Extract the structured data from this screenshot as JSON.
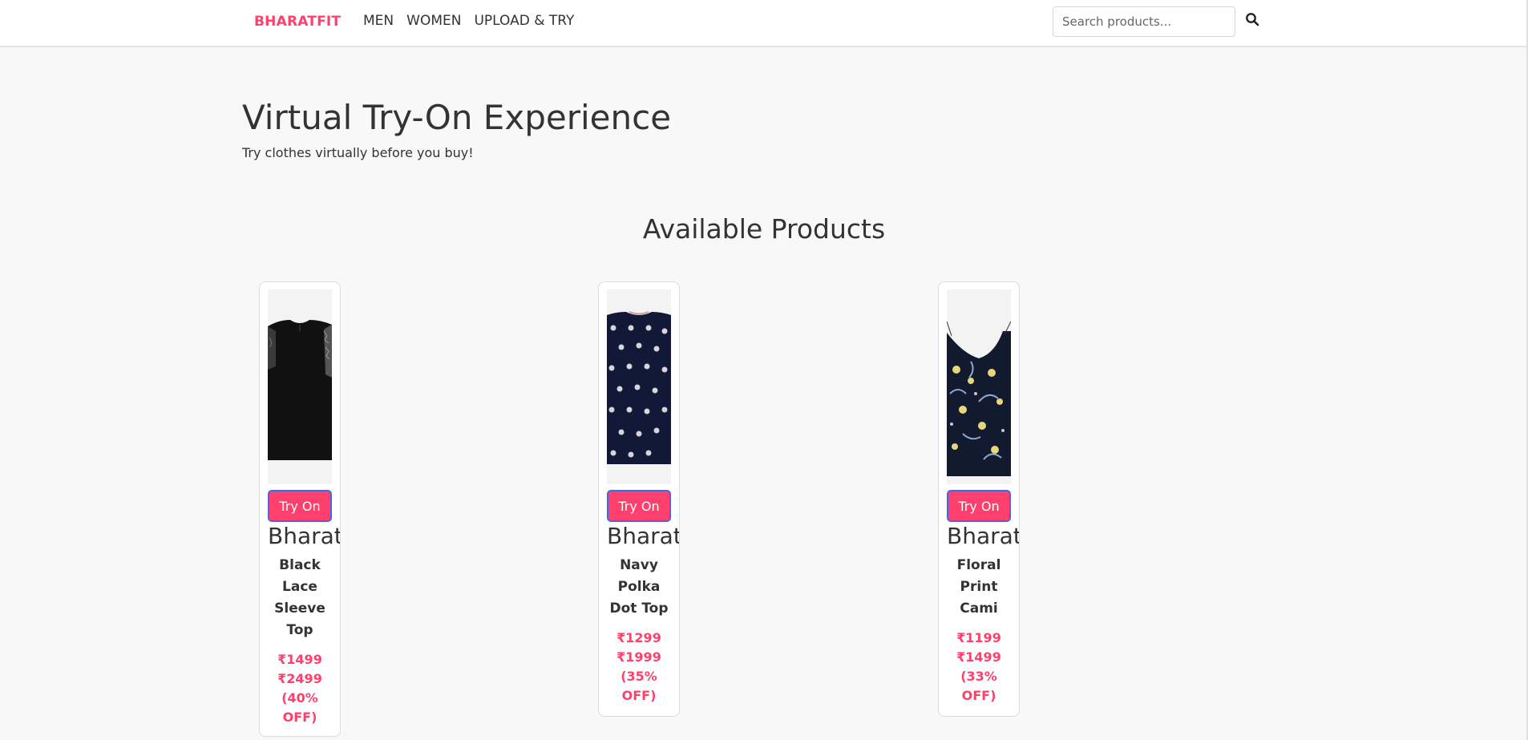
{
  "nav": {
    "brand": "BHARATFIT",
    "links": [
      "MEN",
      "WOMEN",
      "UPLOAD & TRY"
    ],
    "search_placeholder": "Search products...",
    "search_icon": "magnifier-icon"
  },
  "hero": {
    "title": "Virtual Try-On Experience",
    "subtitle": "Try clothes virtually before you buy!"
  },
  "products_section": {
    "title": "Available Products",
    "try_on_label": "Try On",
    "items": [
      {
        "brand": "BharatFit",
        "name": "Black Lace Sleeve Top",
        "price": "₹1499",
        "mrp": "₹2499",
        "discount": "(40% OFF)"
      },
      {
        "brand": "BharatFit",
        "name": "Navy Polka Dot Top",
        "price": "₹1299",
        "mrp": "₹1999",
        "discount": "(35% OFF)"
      },
      {
        "brand": "BharatFit",
        "name": "Floral Print Cami",
        "price": "₹1199",
        "mrp": "₹1499",
        "discount": "(33% OFF)"
      }
    ]
  },
  "colors": {
    "accent": "#ff3f6c",
    "page_bg": "#f8f8f8",
    "text": "#333333"
  }
}
